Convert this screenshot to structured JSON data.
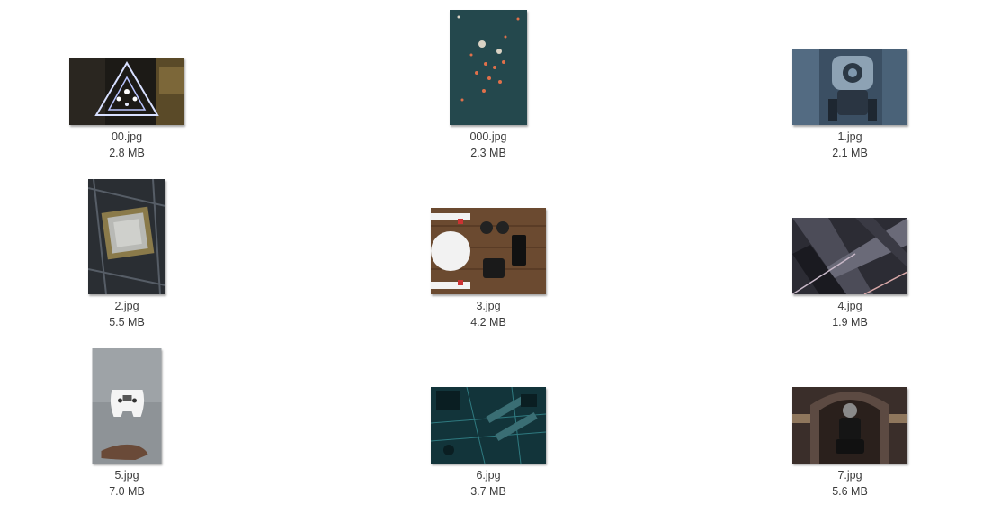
{
  "files": [
    {
      "name": "00.jpg",
      "size": "2.8 MB",
      "thumb": "triangle-neon-image"
    },
    {
      "name": "000.jpg",
      "size": "2.3 MB",
      "thumb": "teal-dots-image"
    },
    {
      "name": "1.jpg",
      "size": "2.1 MB",
      "thumb": "robot-camera-image"
    },
    {
      "name": "2.jpg",
      "size": "5.5 MB",
      "thumb": "cpu-motherboard-image"
    },
    {
      "name": "3.jpg",
      "size": "4.2 MB",
      "thumb": "drone-gear-image"
    },
    {
      "name": "4.jpg",
      "size": "1.9 MB",
      "thumb": "architecture-image"
    },
    {
      "name": "5.jpg",
      "size": "7.0 MB",
      "thumb": "floating-controller-image"
    },
    {
      "name": "6.jpg",
      "size": "3.7 MB",
      "thumb": "circuit-board-image"
    },
    {
      "name": "7.jpg",
      "size": "5.6 MB",
      "thumb": "astronaut-corridor-image"
    }
  ]
}
